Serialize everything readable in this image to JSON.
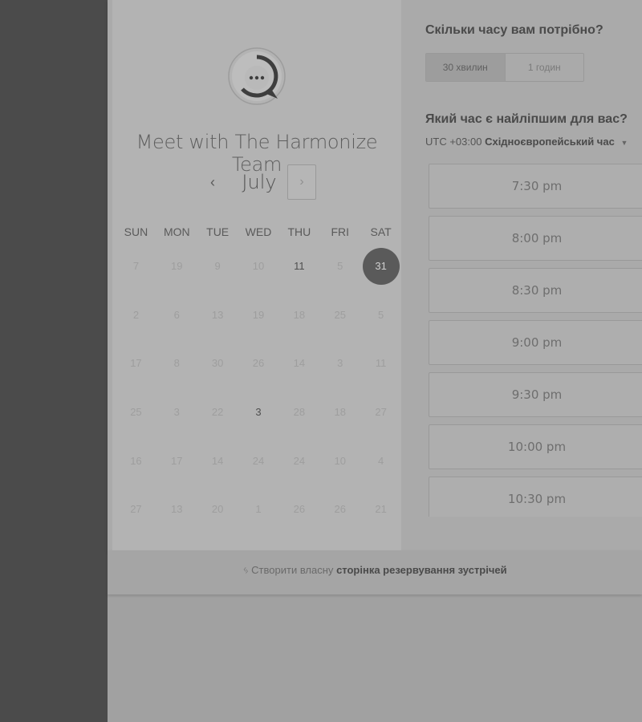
{
  "booking": {
    "title": "Meet with The Harmonize Team",
    "month": "July",
    "prev_icon": "‹",
    "next_icon": "›"
  },
  "calendar": {
    "weekdays": [
      "SUN",
      "MON",
      "TUE",
      "WED",
      "THU",
      "FRI",
      "SAT"
    ],
    "weeks": [
      [
        {
          "d": "7"
        },
        {
          "d": "19"
        },
        {
          "d": "9"
        },
        {
          "d": "10"
        },
        {
          "d": "11",
          "available": true
        },
        {
          "d": "5"
        },
        {
          "d": "31",
          "selected": true
        }
      ],
      [
        {
          "d": "2"
        },
        {
          "d": "6"
        },
        {
          "d": "13"
        },
        {
          "d": "19"
        },
        {
          "d": "18"
        },
        {
          "d": "25"
        },
        {
          "d": "5"
        }
      ],
      [
        {
          "d": "17"
        },
        {
          "d": "8"
        },
        {
          "d": "30"
        },
        {
          "d": "26"
        },
        {
          "d": "14"
        },
        {
          "d": "3"
        },
        {
          "d": "11"
        }
      ],
      [
        {
          "d": "25"
        },
        {
          "d": "3"
        },
        {
          "d": "22"
        },
        {
          "d": "3",
          "available": true
        },
        {
          "d": "28"
        },
        {
          "d": "18"
        },
        {
          "d": "27"
        }
      ],
      [
        {
          "d": "16"
        },
        {
          "d": "17"
        },
        {
          "d": "14"
        },
        {
          "d": "24"
        },
        {
          "d": "24"
        },
        {
          "d": "10"
        },
        {
          "d": "4"
        }
      ],
      [
        {
          "d": "27"
        },
        {
          "d": "13"
        },
        {
          "d": "20"
        },
        {
          "d": "1"
        },
        {
          "d": "26"
        },
        {
          "d": "26"
        },
        {
          "d": "21"
        }
      ]
    ]
  },
  "duration": {
    "question": "Скільки часу вам потрібно?",
    "options": [
      {
        "label": "30 хвилин",
        "active": true
      },
      {
        "label": "1 годин",
        "active": false
      }
    ]
  },
  "time": {
    "question": "Який час є найліпшим для вас?",
    "tz_offset": "UTC +03:00",
    "tz_name": "Східноєвропейський час",
    "caret": "▼",
    "slots": [
      "7:30 pm",
      "8:00 pm",
      "8:30 pm",
      "9:00 pm",
      "9:30 pm",
      "10:00 pm",
      "10:30 pm"
    ]
  },
  "footer": {
    "icon": "ᛃ",
    "prefix": "Створити власну",
    "link": "сторінка резервування зустрічей"
  },
  "colors": {
    "selected_day": "#5a5a5a",
    "left_strip": "#4b4b4b"
  }
}
